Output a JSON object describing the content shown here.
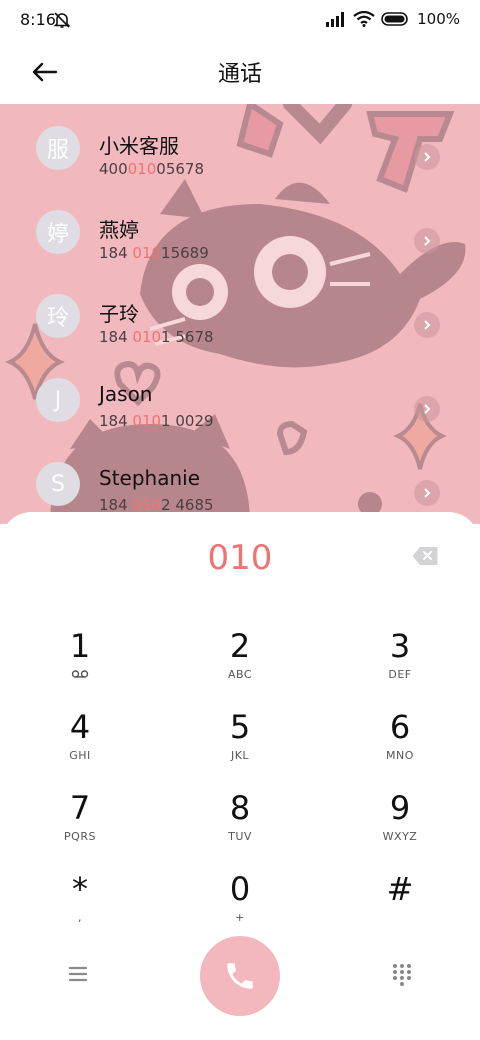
{
  "status_bar": {
    "time": "8:16",
    "battery": "100%"
  },
  "header": {
    "title": "通话"
  },
  "contacts": [
    {
      "avatar": "服",
      "name": "小米客服",
      "num_pre": "400",
      "num_hl": "010",
      "num_post": "05678"
    },
    {
      "avatar": "婷",
      "name": "燕婷",
      "num_pre": "184 ",
      "num_hl": "010",
      "num_post": "15689"
    },
    {
      "avatar": "玲",
      "name": "子玲",
      "num_pre": "184 ",
      "num_hl": "010",
      "num_post": "1 5678"
    },
    {
      "avatar": "J",
      "name": "Jason",
      "num_pre": "184 ",
      "num_hl": "010",
      "num_post": "1 0029"
    },
    {
      "avatar": "S",
      "name": "Stephanie",
      "num_pre": "184 ",
      "num_hl": "010",
      "num_post": "2 4685"
    }
  ],
  "dialer": {
    "input": "010",
    "keys": [
      {
        "digit": "1",
        "letters": ""
      },
      {
        "digit": "2",
        "letters": "ABC"
      },
      {
        "digit": "3",
        "letters": "DEF"
      },
      {
        "digit": "4",
        "letters": "GHI"
      },
      {
        "digit": "5",
        "letters": "JKL"
      },
      {
        "digit": "6",
        "letters": "MNO"
      },
      {
        "digit": "7",
        "letters": "PQRS"
      },
      {
        "digit": "8",
        "letters": "TUV"
      },
      {
        "digit": "9",
        "letters": "WXYZ"
      },
      {
        "digit": "*",
        "letters": ","
      },
      {
        "digit": "0",
        "letters": "+"
      },
      {
        "digit": "#",
        "letters": ""
      }
    ]
  },
  "colors": {
    "accent": "#f27272",
    "call_button": "#f2b8be",
    "wallpaper": "#f1b9be"
  },
  "icons": {
    "back": "arrow-left-icon",
    "backspace": "backspace-icon",
    "menu": "menu-icon",
    "call": "phone-icon",
    "keypad": "dialpad-icon",
    "voicemail": "voicemail-icon"
  }
}
